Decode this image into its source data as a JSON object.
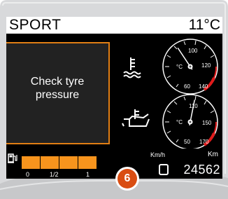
{
  "display": {
    "mode": "SPORT",
    "outside_temp": "11°C"
  },
  "warning": {
    "line1": "Check tyre",
    "line2": "pressure"
  },
  "gauges": {
    "coolant": {
      "icon": "coolant-temperature-icon",
      "unit": "°C",
      "ticks": [
        "60",
        "100",
        "120",
        "140"
      ],
      "needle_value": 90
    },
    "oil": {
      "icon": "oil-temperature-icon",
      "unit": "°C",
      "ticks": [
        "50",
        "110",
        "150",
        "170"
      ],
      "needle_value": 115
    }
  },
  "fuel": {
    "icon": "fuel-pump-icon",
    "labels": [
      "0",
      "1/2",
      "1"
    ],
    "level": 0.9
  },
  "speed": {
    "unit": "Km/h",
    "value": ""
  },
  "odometer": {
    "unit": "Km",
    "value": "24562"
  },
  "callout": {
    "number": "6"
  },
  "colors": {
    "accent_orange": "#e07e14",
    "fuel_orange": "#f7941d",
    "callout_red": "#d94d12",
    "redline": "#e01a1a"
  }
}
